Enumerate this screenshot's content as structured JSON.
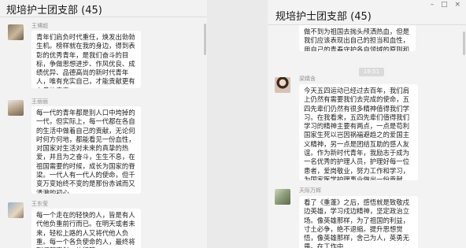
{
  "left": {
    "title": "规培护士团支部 (45)",
    "messages": [
      {
        "name": "王博超",
        "text": "青年们肩负时代重任，焕发出勃勃生机。榜样就在我的身边，得到表彰的优秀青年，是我们奋斗的目标，争做思想进步、作风优良、成绩优异、品德高尚的新时代青年人，唯有充实自己，才能贡献更有力量的青春。"
      },
      {
        "name": "王丽丽",
        "text": "每一代的青年都是别人口中垮掉的一代，但实际上，每一代都在各自的生活中做着自己的贡献，无论何时何方何地，都能看见一份血性，对国家对生活对未来的真挚的热爱，并且为之奋斗，生生不息，在祖国需要的时候，成长为国家的脊梁。一代人有一代人的使命，但千变万变始终不变的是那份赤诚而又清澈的初心。"
      },
      {
        "name": "王东莹",
        "text": "每一个走在的轻快的人，皆是有人代他负重前行而已。在明天或者未来，轻松上路的人又将代他人负重。每一个各负使命的人，最终将列归整齐划一的行阵，"
      }
    ]
  },
  "right": {
    "title": "规培护士团支部 (45)",
    "window_controls": "– □ ×",
    "top_text": "做不到为祖国去抛头颅洒热血，但是我们应该表现出自己的担当和血性，用自己的青春守护各自领域的原则和底",
    "timestamp": "19:51",
    "messages": [
      {
        "name": "梁婧含",
        "text": "今天五四运动已经过去百年，我们肩上仍然有需要我们去完成的使命，五四先辈们仍然有很多精神值得我们学习。在我看来，五四先辈们值得我们学习的精神主要有两点，一点是苟利国家生死以岂因祸福避趋之的爱国主义精神，另一点是团结互助的感人友谊。作为新时代青年，我励志于成为一名优秀的护理人员，护理好每一位患者，爱岗敬业，努力工作和学习，为国家医学护理事业做出一份贡献。"
      },
      {
        "name": "天际万辉",
        "text": "看了《重蓬》之后，感悟就是致敬戍边英雄，学习戍边精神，坚定政治立场。像英雄那样，为了祖国的利益，寸土必争，绝不退缩。提升思想觉悟，像英雄那样，舍己为人，英勇无畏。在工作中"
      }
    ]
  }
}
